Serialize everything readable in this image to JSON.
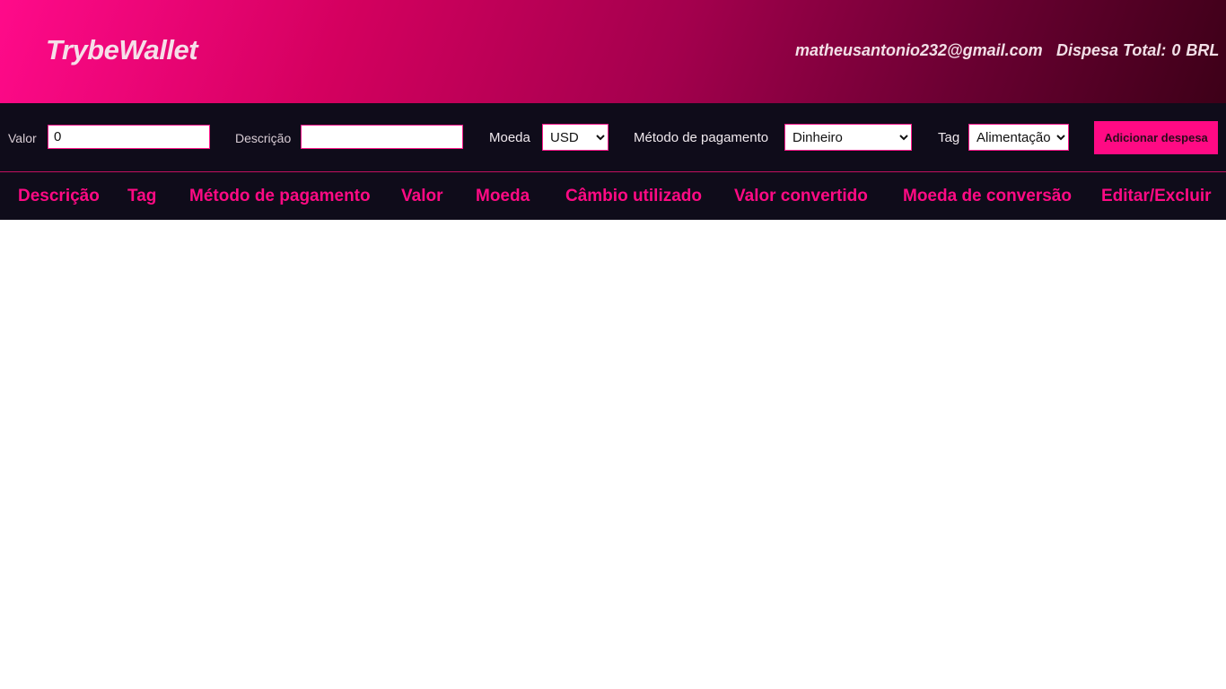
{
  "header": {
    "logo": "TrybeWallet",
    "email": "matheusantonio232@gmail.com",
    "total_label": "Dispesa Total:",
    "total_value": "0",
    "currency": "BRL"
  },
  "form": {
    "valor_label": "Valor",
    "valor_value": "0",
    "descricao_label": "Descrição",
    "descricao_value": "",
    "moeda_label": "Moeda",
    "moeda_selected": "USD",
    "metodo_label": "Método de pagamento",
    "metodo_selected": "Dinheiro",
    "tag_label": "Tag",
    "tag_selected": "Alimentação",
    "add_button": "Adicionar despesa"
  },
  "table": {
    "headers": [
      "Descrição",
      "Tag",
      "Método de pagamento",
      "Valor",
      "Moeda",
      "Câmbio utilizado",
      "Valor convertido",
      "Moeda de conversão",
      "Editar/Excluir"
    ]
  },
  "colors": {
    "accent": "#ff0a84",
    "bar_background": "#0f0c1a",
    "gradient_start": "#ff0a8a",
    "gradient_end": "#3d0018"
  }
}
